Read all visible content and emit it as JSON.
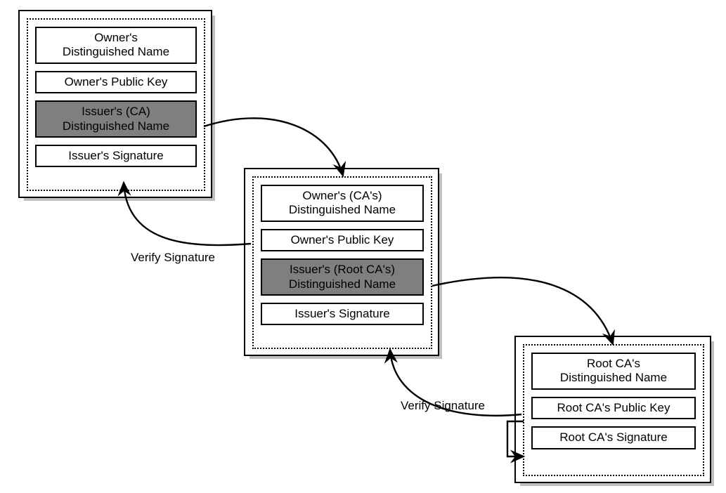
{
  "cert1": {
    "owner_dn": "Owner's\nDistinguished Name",
    "owner_pk": "Owner's Public Key",
    "issuer_dn": "Issuer's (CA)\nDistinguished Name",
    "issuer_sig": "Issuer's Signature"
  },
  "cert2": {
    "owner_dn": "Owner's (CA's)\nDistinguished Name",
    "owner_pk": "Owner's Public Key",
    "issuer_dn": "Issuer's (Root CA's)\nDistinguished Name",
    "issuer_sig": "Issuer's Signature"
  },
  "cert3": {
    "owner_dn": "Root CA's\nDistinguished Name",
    "owner_pk": "Root CA's Public Key",
    "owner_sig": "Root CA's Signature"
  },
  "labels": {
    "verify1": "Verify Signature",
    "verify2": "Verify Signature"
  }
}
